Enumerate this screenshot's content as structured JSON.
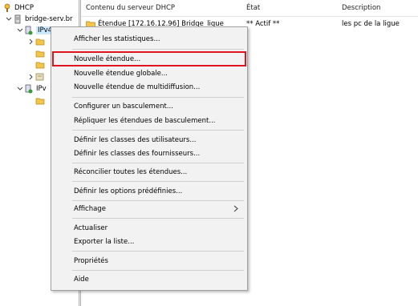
{
  "tree": {
    "root_label": "DHCP",
    "server_label": "bridge-serv.br",
    "ipv4_label": "IPv4",
    "ipv6_label": "IPv"
  },
  "columns": {
    "content": "Contenu du serveur DHCP",
    "state": "État",
    "description": "Description"
  },
  "rows": [
    {
      "content": "Étendue [172.16.12.96] Bridge_ligue",
      "state": "** Actif **",
      "description": "les pc de la ligue"
    }
  ],
  "context_menu": {
    "items": [
      "Afficher les statistiques...",
      "Nouvelle étendue...",
      "Nouvelle étendue globale...",
      "Nouvelle étendue de multidiffusion...",
      "Configurer un basculement...",
      "Répliquer les étendues de basculement...",
      "Définir les classes des utilisateurs...",
      "Définir les classes des fournisseurs...",
      "Réconcilier toutes les étendues...",
      "Définir les options prédéfinies...",
      "Affichage",
      "Actualiser",
      "Exporter la liste...",
      "Propriétés",
      "Aide"
    ],
    "highlighted": "Nouvelle étendue...",
    "highlight_color": "#e0141e"
  }
}
